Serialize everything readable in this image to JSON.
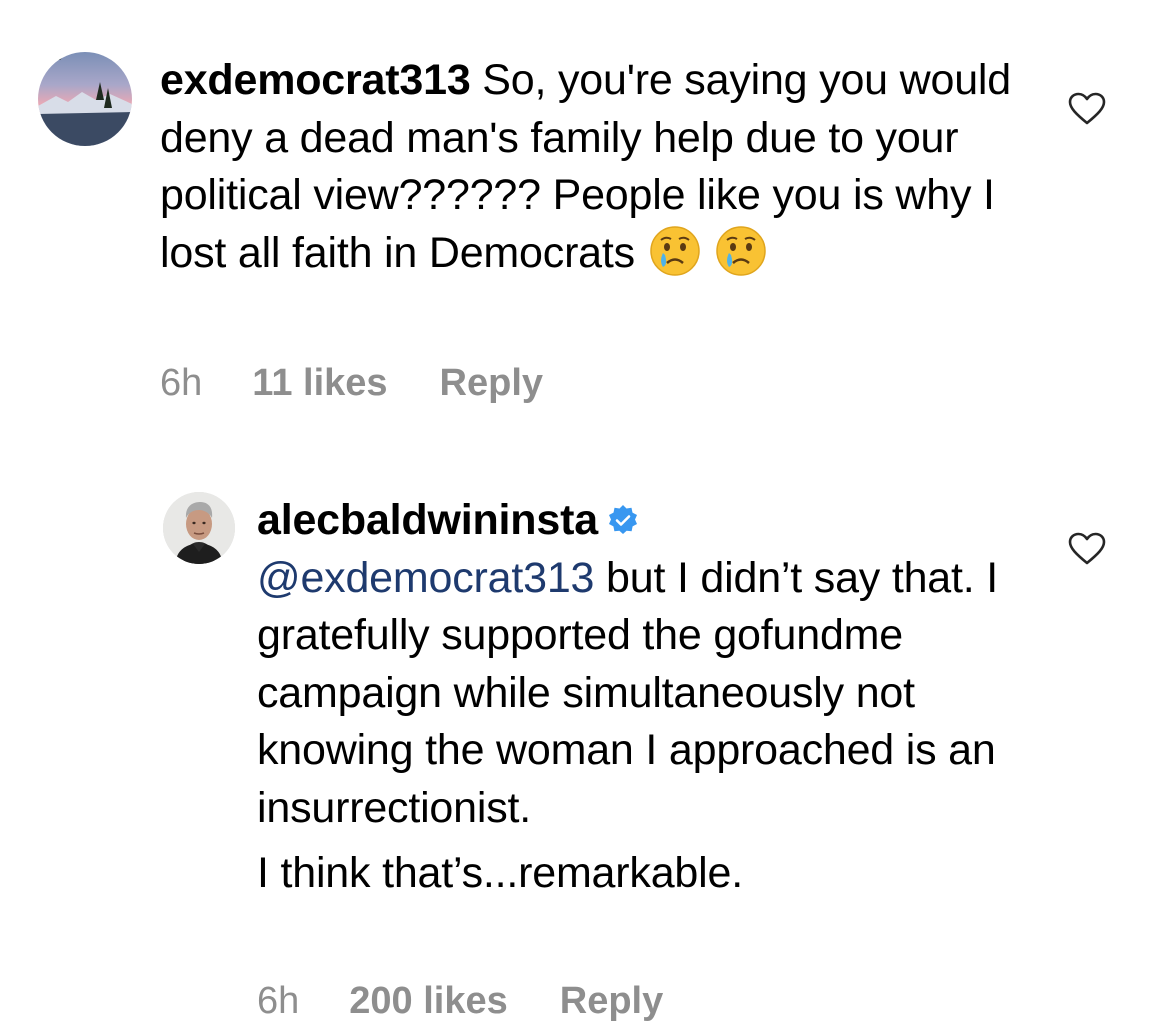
{
  "comments": [
    {
      "username": "exdemocrat313",
      "text": "So, you're saying you would deny a dead man's family help due to your political view?????? People like you is why I lost all faith in Democrats",
      "emojis": [
        "crying-face-emoji",
        "crying-face-emoji"
      ],
      "time": "6h",
      "likes": "11 likes",
      "reply": "Reply",
      "avatar": "landscape-sunset-avatar",
      "like_icon": "heart-outline-icon"
    },
    {
      "username": "alecbaldwininsta",
      "verified": true,
      "mention": "@exdemocrat313",
      "text": "but I didn’t say that. I gratefully supported the gofundme campaign while simultaneously not knowing the woman I approached is an insurrectionist.",
      "text2": "I think that’s...remarkable.",
      "time": "6h",
      "likes": "200 likes",
      "reply": "Reply",
      "avatar": "man-portrait-avatar",
      "like_icon": "heart-outline-icon"
    }
  ],
  "colors": {
    "text": "#000000",
    "meta": "#8e8e8e",
    "mention": "#1e3a6e",
    "verified": "#3897f0"
  }
}
